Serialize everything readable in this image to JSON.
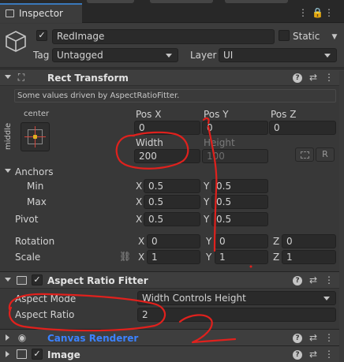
{
  "tab": {
    "title": "Inspector"
  },
  "object": {
    "name": "RedImage",
    "active": true,
    "static_label": "Static",
    "tag_label": "Tag",
    "tag_value": "Untagged",
    "layer_label": "Layer",
    "layer_value": "UI"
  },
  "rect_transform": {
    "title": "Rect Transform",
    "driven_note": "Some values driven by AspectRatioFitter.",
    "anchor_h": "center",
    "anchor_v": "middle",
    "headers": [
      "Pos X",
      "Pos Y",
      "Pos Z"
    ],
    "pos": [
      "0",
      "0",
      "0"
    ],
    "width_label": "Width",
    "height_label": "Height",
    "width": "200",
    "height": "100",
    "r_button": "R",
    "anchors_label": "Anchors",
    "min_label": "Min",
    "max_label": "Max",
    "min": [
      "0.5",
      "0.5"
    ],
    "max": [
      "0.5",
      "0.5"
    ],
    "pivot_label": "Pivot",
    "pivot": [
      "0.5",
      "0.5"
    ],
    "rotation_label": "Rotation",
    "rotation": [
      "0",
      "0",
      "0"
    ],
    "scale_label": "Scale",
    "scale": [
      "1",
      "1",
      "1"
    ],
    "axis_x": "X",
    "axis_y": "Y",
    "axis_z": "Z"
  },
  "aspect_ratio_fitter": {
    "title": "Aspect Ratio Fitter",
    "enabled": true,
    "mode_label": "Aspect Mode",
    "mode_value": "Width Controls Height",
    "ratio_label": "Aspect Ratio",
    "ratio_value": "2"
  },
  "canvas_renderer": {
    "title": "Canvas Renderer"
  },
  "image": {
    "title": "Image",
    "enabled": true
  },
  "colors": {
    "bg": "#383838",
    "header": "#3e3e3e",
    "field": "#2a2a2a",
    "annotation": "#e0211d",
    "link": "#3b82ff"
  }
}
